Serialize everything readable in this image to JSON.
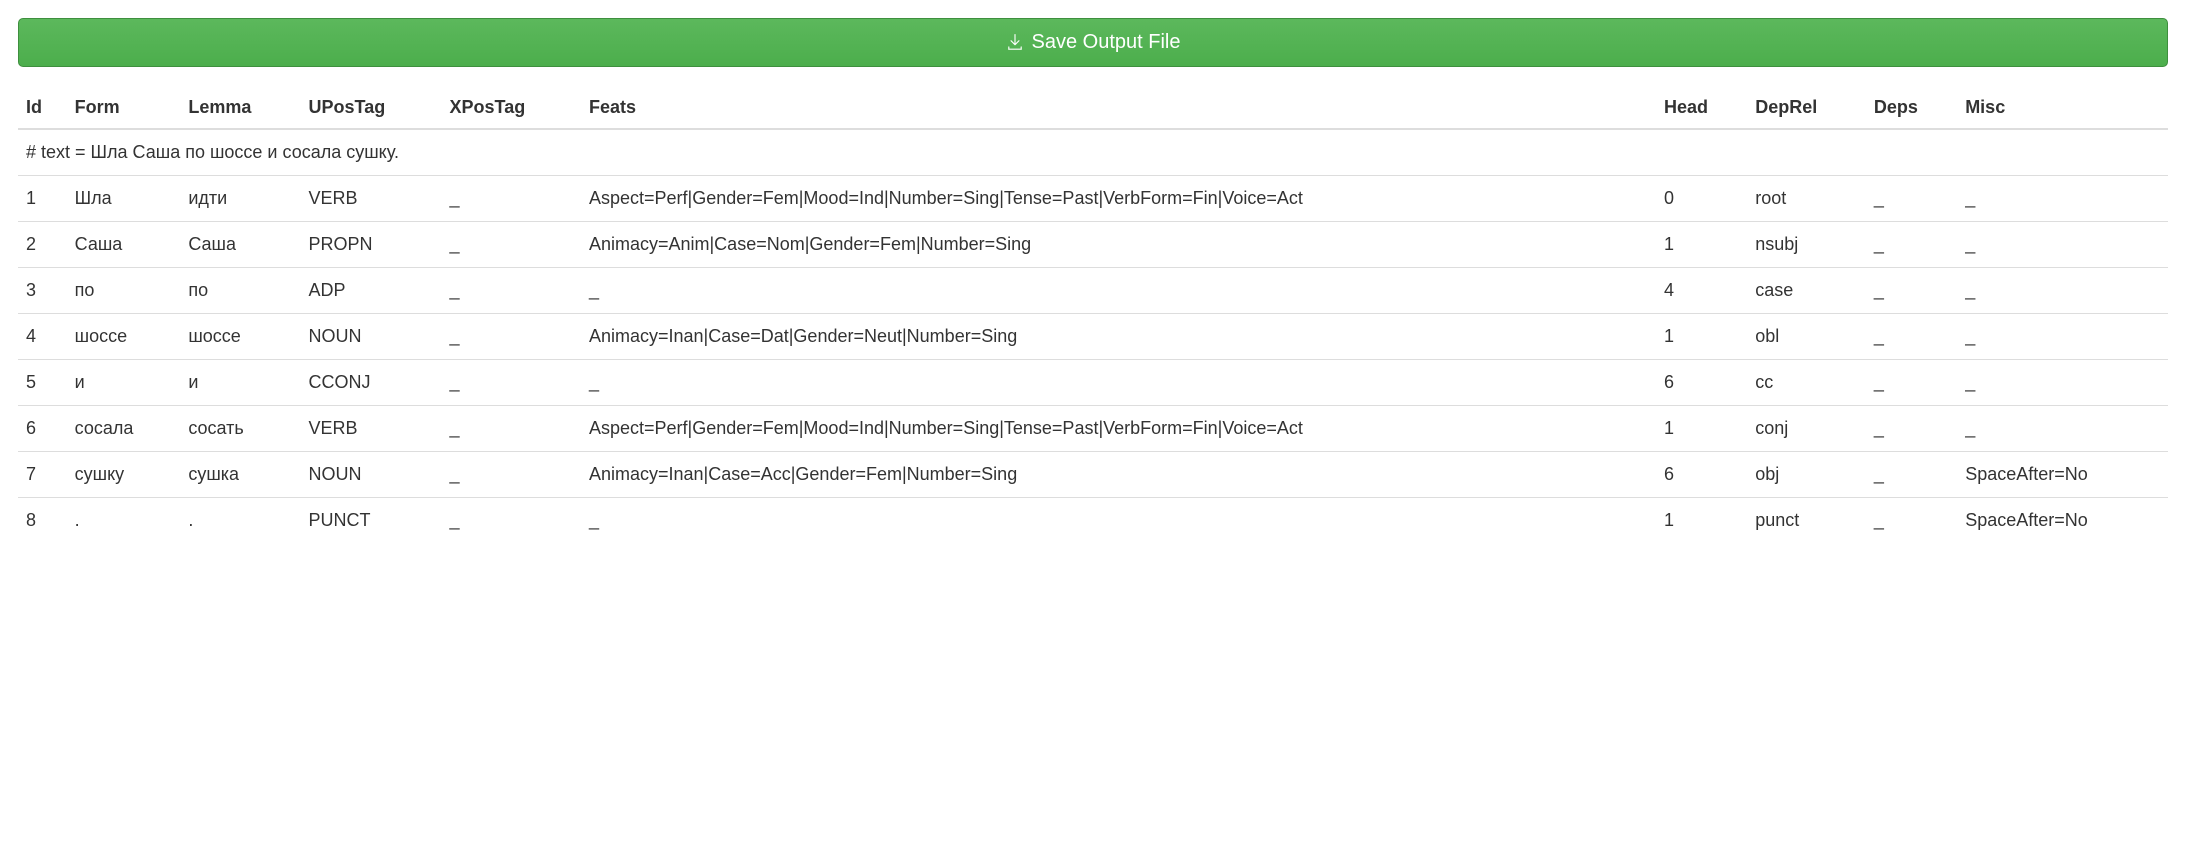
{
  "buttons": {
    "save_output": "Save Output File"
  },
  "table": {
    "headers": {
      "id": "Id",
      "form": "Form",
      "lemma": "Lemma",
      "upostag": "UPosTag",
      "xpostag": "XPosTag",
      "feats": "Feats",
      "head": "Head",
      "deprel": "DepRel",
      "deps": "Deps",
      "misc": "Misc"
    },
    "sentence_text": "# text = Шла Саша по шоссе и сосала сушку.",
    "rows": [
      {
        "id": "1",
        "form": "Шла",
        "lemma": "идти",
        "upostag": "VERB",
        "xpostag": "_",
        "feats": "Aspect=Perf|Gender=Fem|Mood=Ind|Number=Sing|Tense=Past|VerbForm=Fin|Voice=Act",
        "head": "0",
        "deprel": "root",
        "deps": "_",
        "misc": "_"
      },
      {
        "id": "2",
        "form": "Саша",
        "lemma": "Саша",
        "upostag": "PROPN",
        "xpostag": "_",
        "feats": "Animacy=Anim|Case=Nom|Gender=Fem|Number=Sing",
        "head": "1",
        "deprel": "nsubj",
        "deps": "_",
        "misc": "_"
      },
      {
        "id": "3",
        "form": "по",
        "lemma": "по",
        "upostag": "ADP",
        "xpostag": "_",
        "feats": "_",
        "head": "4",
        "deprel": "case",
        "deps": "_",
        "misc": "_"
      },
      {
        "id": "4",
        "form": "шоссе",
        "lemma": "шоссе",
        "upostag": "NOUN",
        "xpostag": "_",
        "feats": "Animacy=Inan|Case=Dat|Gender=Neut|Number=Sing",
        "head": "1",
        "deprel": "obl",
        "deps": "_",
        "misc": "_"
      },
      {
        "id": "5",
        "form": "и",
        "lemma": "и",
        "upostag": "CCONJ",
        "xpostag": "_",
        "feats": "_",
        "head": "6",
        "deprel": "cc",
        "deps": "_",
        "misc": "_"
      },
      {
        "id": "6",
        "form": "сосала",
        "lemma": "сосать",
        "upostag": "VERB",
        "xpostag": "_",
        "feats": "Aspect=Perf|Gender=Fem|Mood=Ind|Number=Sing|Tense=Past|VerbForm=Fin|Voice=Act",
        "head": "1",
        "deprel": "conj",
        "deps": "_",
        "misc": "_"
      },
      {
        "id": "7",
        "form": "сушку",
        "lemma": "сушка",
        "upostag": "NOUN",
        "xpostag": "_",
        "feats": "Animacy=Inan|Case=Acc|Gender=Fem|Number=Sing",
        "head": "6",
        "deprel": "obj",
        "deps": "_",
        "misc": "SpaceAfter=No"
      },
      {
        "id": "8",
        "form": ".",
        "lemma": ".",
        "upostag": "PUNCT",
        "xpostag": "_",
        "feats": "_",
        "head": "1",
        "deprel": "punct",
        "deps": "_",
        "misc": "SpaceAfter=No"
      }
    ]
  }
}
